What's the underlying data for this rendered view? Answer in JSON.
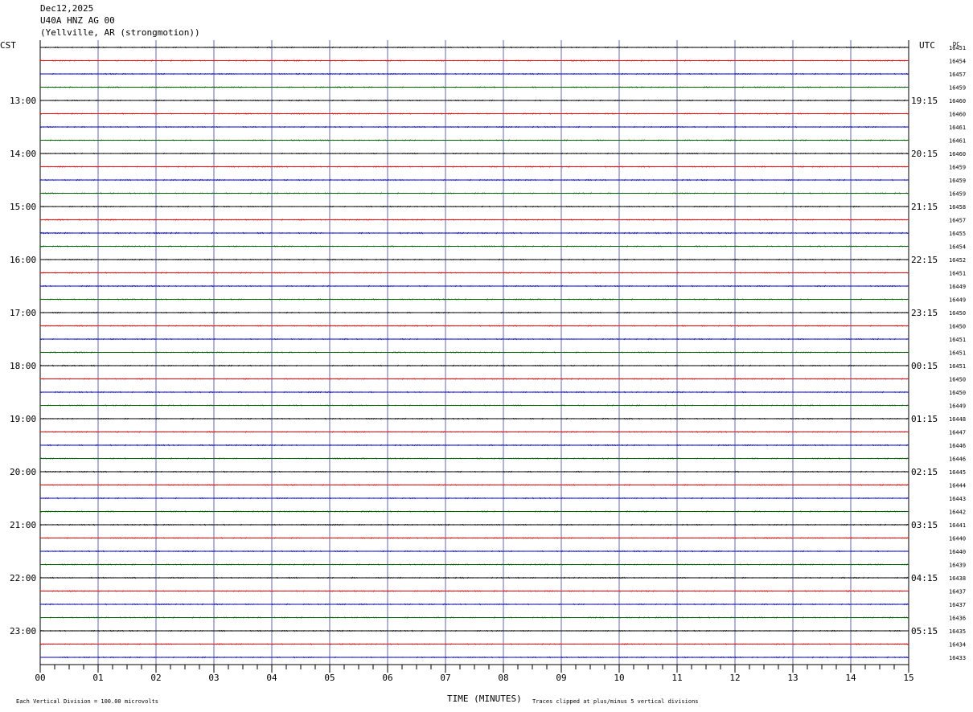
{
  "header": {
    "date": "Dec12,2025",
    "station": "U40A HNZ AG 00",
    "location": "(Yellville, AR (strongmotion))"
  },
  "labels": {
    "left_zone": "CST",
    "right_zone": "UTC",
    "dc": "DC",
    "xaxis_title": "TIME (MINUTES)",
    "scale_note": "Each Vertical Division = 100.00 microvolts",
    "clip_note": "Traces clipped at plus/minus 5 vertical divisions"
  },
  "colors": {
    "black": "#000000",
    "red": "#ee0000",
    "blue": "#0000cc",
    "green": "#006600",
    "grid": "#6666aa"
  },
  "chart_data": {
    "type": "line",
    "title": "U40A HNZ AG 00",
    "xlabel": "TIME (MINUTES)",
    "xlim": [
      0,
      15
    ],
    "x_ticks": [
      "00",
      "01",
      "02",
      "03",
      "04",
      "05",
      "06",
      "07",
      "08",
      "09",
      "10",
      "11",
      "12",
      "13",
      "14",
      "15"
    ],
    "trace_colors_cycle": [
      "black",
      "red",
      "blue",
      "green"
    ],
    "hour_labels_cst": [
      "13:00",
      "14:00",
      "15:00",
      "16:00",
      "17:00",
      "18:00",
      "19:00",
      "20:00",
      "21:00",
      "22:00",
      "23:00"
    ],
    "hour_labels_utc": [
      "19:15",
      "20:15",
      "21:15",
      "22:15",
      "23:15",
      "00:15",
      "01:15",
      "02:15",
      "03:15",
      "04:15",
      "05:15"
    ],
    "hour_label_start_row": 4,
    "dc_offsets": [
      16451,
      16454,
      16457,
      16459,
      16460,
      16460,
      16461,
      16461,
      16460,
      16459,
      16459,
      16459,
      16458,
      16457,
      16455,
      16454,
      16452,
      16451,
      16449,
      16449,
      16450,
      16450,
      16451,
      16451,
      16451,
      16450,
      16450,
      16449,
      16448,
      16447,
      16446,
      16446,
      16445,
      16444,
      16443,
      16442,
      16441,
      16440,
      16440,
      16439,
      16438,
      16437,
      16437,
      16436,
      16435,
      16434,
      16433
    ],
    "noise_level": [
      1.0,
      1.0,
      1.0,
      1.0,
      1.0,
      1.0,
      1.0,
      1.0,
      1.0,
      1.0,
      1.0,
      1.0,
      1.0,
      1.0,
      1.2,
      1.0,
      1.0,
      1.0,
      1.0,
      1.0,
      1.0,
      1.0,
      1.0,
      1.0,
      1.0,
      1.0,
      1.0,
      1.0,
      1.0,
      1.0,
      1.0,
      1.0,
      1.0,
      1.0,
      1.0,
      1.0,
      1.0,
      1.0,
      1.0,
      1.0,
      1.0,
      1.0,
      1.0,
      1.0,
      1.0,
      1.0,
      1.0
    ]
  }
}
